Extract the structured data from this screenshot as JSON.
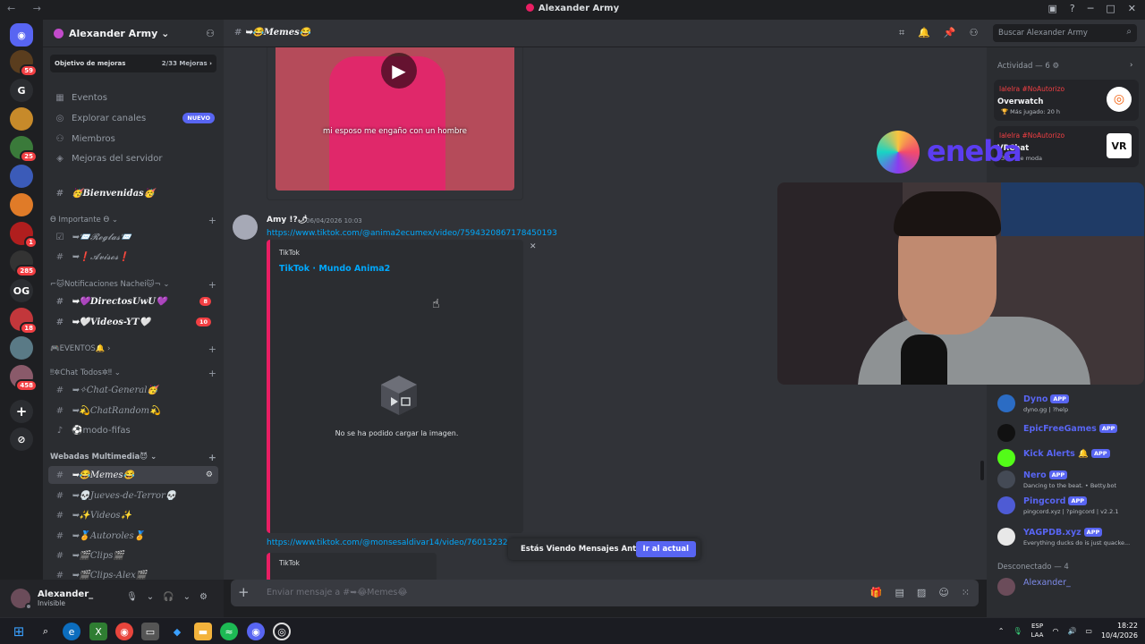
{
  "window": {
    "title": "Alexander Army",
    "nav": "← →"
  },
  "servers": [
    {
      "label": "",
      "badge": "59",
      "color": "#5a3d1e"
    },
    {
      "label": "G",
      "badge": "",
      "color": "#2b2d31"
    },
    {
      "label": "",
      "badge": "",
      "color": "#c78a2a"
    },
    {
      "label": "",
      "badge": "25",
      "color": "#3a7a3a"
    },
    {
      "label": "",
      "badge": "",
      "color": "#3b5bb8"
    },
    {
      "label": "",
      "badge": "",
      "color": "#e07b28"
    },
    {
      "label": "",
      "badge": "1",
      "color": "#b01e1e"
    },
    {
      "label": "",
      "badge": "285",
      "color": "#333333"
    },
    {
      "label": "OG",
      "badge": "",
      "color": "#2b2d31"
    },
    {
      "label": "",
      "badge": "18",
      "color": "#c2373b"
    },
    {
      "label": "",
      "badge": "",
      "color": "#5a7a86"
    },
    {
      "label": "",
      "badge": "458",
      "color": "#8a5a6a"
    }
  ],
  "server": {
    "name": "Alexander Army",
    "boost_label": "Objetivo de mejoras",
    "boost_progress": "2/33 Mejoras",
    "menu": [
      {
        "icon": "calendar-icon",
        "glyph": "▦",
        "label": "Eventos"
      },
      {
        "icon": "compass-icon",
        "glyph": "◎",
        "label": "Explorar canales",
        "tag": "NUEVO"
      },
      {
        "icon": "members-icon",
        "glyph": "👥",
        "label": "Miembros"
      },
      {
        "icon": "boost-icon",
        "glyph": "◈",
        "label": "Mejoras del servidor"
      }
    ],
    "channels": {
      "bienvenidas": "🥳Bienvenidas🥳",
      "cat_importante": "ϴ Importante ϴ",
      "reglas": "➥📨𝓡𝓮𝓰𝓵𝓪𝓼📨",
      "avisos": "➥❗𝓐𝓿𝓲𝓼𝓸𝓼❗",
      "cat_notif": "⌐🐱Notificaciones Nachei🐱¬",
      "directo": "➥💜DirectosUwU💜",
      "directo_count": "8",
      "videos_yt": "➥🤍Videos-YT🤍",
      "videos_yt_count": "10",
      "cat_eventos": "🎮EVENTOS🔔",
      "cat_chat": "‼✲Chat Todos✲‼",
      "chat_general": "➥✧Chat-General🥳",
      "chat_random": "➥💫ChatRandom💫",
      "modo_fifas": "⚽modo-fifas",
      "cat_webadas": "Webadas Multimedia😈",
      "memes": "➥😂Memes😂",
      "jueves": "➥💀Jueves-de-Terror💀",
      "videos": "➥✨Videos✨",
      "autoroles": "➥🏅Autoroles🏅",
      "clips": "➥🎬Clips🎬",
      "cut": "➥🎬Clips-Alex🎬"
    }
  },
  "user": {
    "name": "Alexander_",
    "status": "Invisible"
  },
  "channel": {
    "name": "➥😂Memes😂",
    "search_placeholder": "Buscar Alexander Army"
  },
  "messages": {
    "video_caption": "mi esposo me engaño con un hombre",
    "author": "Amy !?🌶",
    "time": "06/04/2026 10:03",
    "link1": "https://www.tiktok.com/@anima2ecumex/video/7594320867178450193",
    "embed_provider": "TikTok",
    "embed_title": "TikTok · Mundo Anima2",
    "embed_error": "No se ha podido cargar la imagen.",
    "link2": "https://www.tiktok.com/@monsesaldivar14/video/76013232",
    "embed2_provider": "TikTok"
  },
  "jump": {
    "text": "Estás Viendo Mensajes Antiguos",
    "button": "Ir al actual"
  },
  "composer": {
    "placeholder": "Enviar mensaje a #➥😂Memes😂"
  },
  "activity": {
    "header": "Actividad — 6",
    "cards": [
      {
        "who": "lalelra #NoAutorizo",
        "game": "Overwatch",
        "sub": "🏆 Más jugado: 20 h"
      },
      {
        "who": "lalelra #NoAutorizo",
        "game": "VRChat",
        "sub": "3 d · De moda"
      }
    ]
  },
  "members": [
    {
      "name": "Dyno",
      "app": "APP",
      "sub": "dyno.gg | ?help",
      "color": "#5865f2",
      "av": "#2b6cc4"
    },
    {
      "name": "EpicFreeGames",
      "app": "APP",
      "sub": "",
      "color": "#5865f2",
      "av": "#111111"
    },
    {
      "name": "Kick Alerts 🔔",
      "app": "APP",
      "sub": "",
      "color": "#5865f2",
      "av": "#53fc18"
    },
    {
      "name": "Nero",
      "app": "APP",
      "sub": "Dancing to the beat. • Betty.bot",
      "color": "#5865f2",
      "av": "#444a55"
    },
    {
      "name": "Pingcord",
      "app": "APP",
      "sub": "pingcord.xyz | ?pingcord | v2.2.1",
      "color": "#5865f2",
      "av": "#4e5bd4"
    },
    {
      "name": "YAGPDB.xyz",
      "app": "APP",
      "sub": "Everything ducks do is just quacke...",
      "color": "#5865f2",
      "av": "#e8e8e8"
    }
  ],
  "offline": {
    "header": "Desconectado — 4",
    "first": "Alexander_"
  },
  "overlay": {
    "brand": "eneba"
  },
  "taskbar": {
    "lang1": "ESP",
    "lang2": "LAA",
    "time": "18:22",
    "date": "10/4/2026"
  }
}
